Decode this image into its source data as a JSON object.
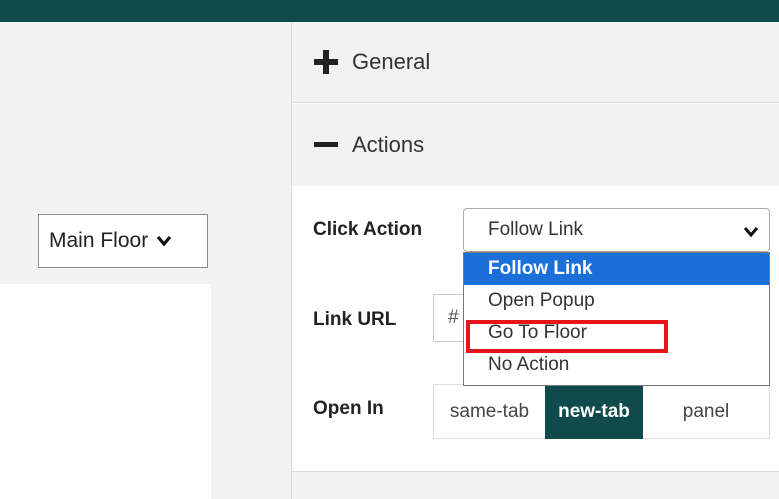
{
  "floor_selector": {
    "value": "Main Floor"
  },
  "sections": {
    "general": {
      "label": "General"
    },
    "actions": {
      "label": "Actions"
    }
  },
  "form": {
    "click_action": {
      "label": "Click Action",
      "value": "Follow Link",
      "options": [
        "Follow Link",
        "Open Popup",
        "Go To Floor",
        "No Action"
      ]
    },
    "link_url": {
      "label": "Link URL",
      "value": "#"
    },
    "open_in": {
      "label": "Open In",
      "options": [
        "same-tab",
        "new-tab",
        "panel"
      ],
      "selected": "new-tab"
    }
  },
  "colors": {
    "brand": "#0f4b4b",
    "selected_option": "#1a6fd8",
    "highlight": "#e8141a",
    "panel_gray": "#f2f2f2"
  }
}
